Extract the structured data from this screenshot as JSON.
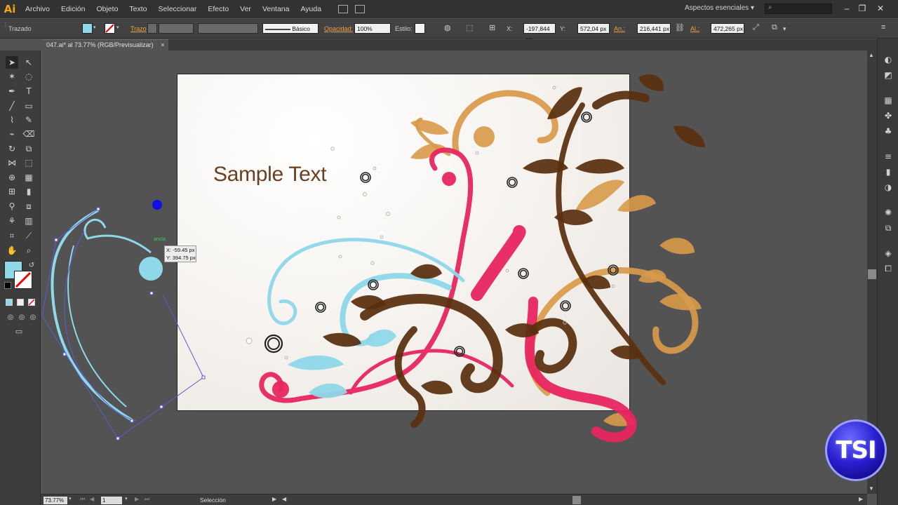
{
  "app": {
    "logo_text": "Ai",
    "menu": [
      "Archivo",
      "Edición",
      "Objeto",
      "Texto",
      "Seleccionar",
      "Efecto",
      "Ver",
      "Ventana",
      "Ayuda"
    ],
    "workspace": "Aspectos esenciales",
    "search_placeholder": ""
  },
  "control_bar": {
    "selection_label": "Trazado",
    "stroke_label": "Trazo",
    "stroke_style": "Básico",
    "opacity_label": "Opacidad:",
    "opacity_value": "100%",
    "style_label": "Estilo:",
    "x_label": "X:",
    "x_value": "-197,844 px",
    "y_label": "Y:",
    "y_value": "572,04 px",
    "width_label": "An.:",
    "width_value": "216,441 px",
    "height_label": "Al.:",
    "height_value": "472,265 px",
    "fill_color": "#8ed8ea"
  },
  "document": {
    "tab_title": "047.ai* al 73.77% (RGB/Previsualizar)",
    "tab_close": "×"
  },
  "canvas": {
    "sample_text": "Sample Text",
    "anchor_label": "ancla",
    "tooltip_x": "X: -59.45 px",
    "tooltip_y": "Y: 394.75 px"
  },
  "status_bar": {
    "zoom": "73.77%",
    "artboard_number": "1",
    "tool_name": "Selección"
  },
  "watermark": {
    "text": "TSI"
  },
  "colors": {
    "brown": "#5a2f0f",
    "pink": "#e8265f",
    "tan": "#d99a4a",
    "cyan": "#8ed8ea",
    "selection": "#5b5bd6"
  }
}
